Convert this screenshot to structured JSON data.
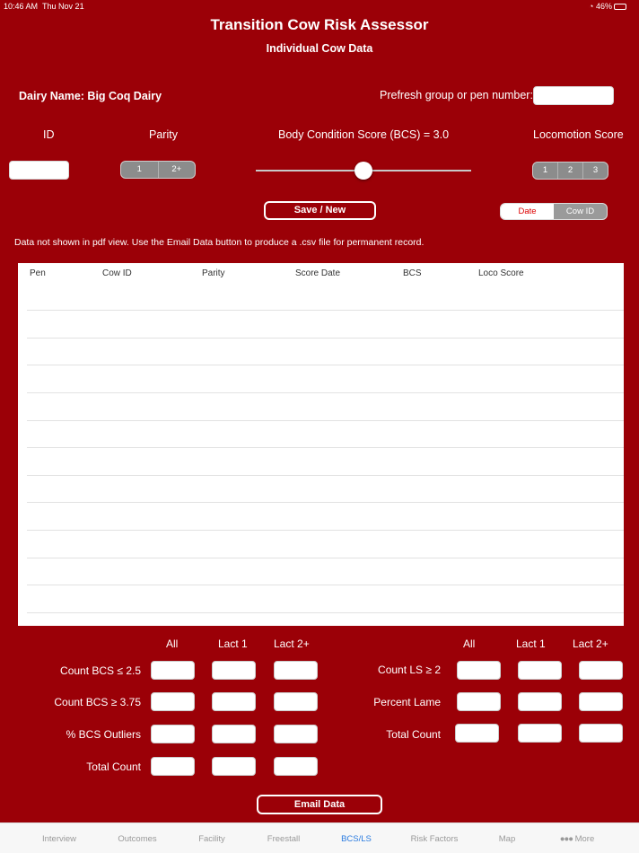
{
  "status_bar": {
    "time": "10:46 AM",
    "date": "Thu Nov 21",
    "battery": "46%"
  },
  "header": {
    "title": "Transition Cow Risk Assessor",
    "subtitle": "Individual Cow Data"
  },
  "dairy": {
    "label": "Dairy Name: Big Coq Dairy"
  },
  "pen": {
    "label": "Prefresh group or pen number:",
    "value": ""
  },
  "controls": {
    "id_label": "ID",
    "id_value": "",
    "parity_label": "Parity",
    "parity_options": [
      "1",
      "2+"
    ],
    "bcs_label": "Body Condition Score (BCS) = 3.0",
    "bcs_value": 3.0,
    "locomotion_label": "Locomotion Score",
    "locomotion_options": [
      "1",
      "2",
      "3"
    ]
  },
  "save_button": "Save / New",
  "sort_toggle": {
    "options": [
      "Date",
      "Cow ID"
    ],
    "selected": "Date"
  },
  "note": "Data not shown in pdf view. Use the Email Data button to produce a .csv file for permanent record.",
  "table": {
    "headers": [
      "Pen",
      "Cow ID",
      "Parity",
      "Score Date",
      "BCS",
      "Loco Score"
    ],
    "rows": []
  },
  "bcs_stats": {
    "columns": [
      "All",
      "Lact 1",
      "Lact 2+"
    ],
    "rows": [
      "Count BCS ≤ 2.5",
      "Count BCS ≥ 3.75",
      "% BCS Outliers",
      "Total Count"
    ]
  },
  "ls_stats": {
    "columns": [
      "All",
      "Lact 1",
      "Lact 2+"
    ],
    "rows": [
      "Count LS ≥ 2",
      "Percent Lame",
      "Total Count"
    ]
  },
  "email_button": "Email Data",
  "tabs": [
    {
      "label": "Interview"
    },
    {
      "label": "Outcomes"
    },
    {
      "label": "Facility"
    },
    {
      "label": "Freestall"
    },
    {
      "label": "BCS/LS",
      "active": true
    },
    {
      "label": "Risk Factors"
    },
    {
      "label": "Map"
    },
    {
      "label": "More",
      "icon": "ellipsis-icon"
    }
  ],
  "colors": {
    "background": "#9b0007",
    "accent_tab": "#2a7be0",
    "toggle_selected_text": "#dd0000"
  }
}
